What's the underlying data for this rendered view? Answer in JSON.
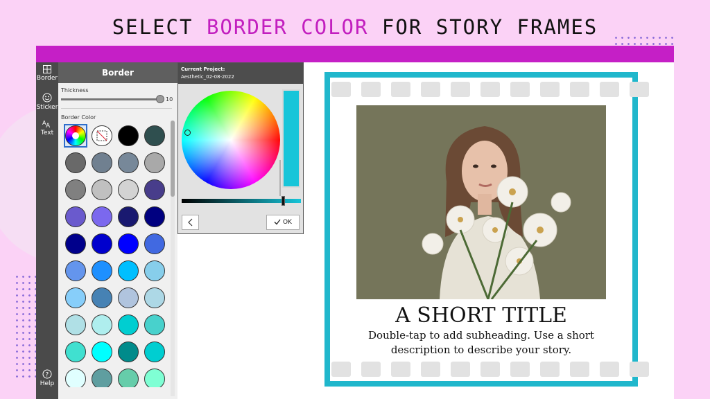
{
  "headline": {
    "part1": "SELECT ",
    "accent": "BORDER COLOR",
    "part2": " FOR STORY FRAMES"
  },
  "colors": {
    "accent": "#c21fbf",
    "border_selected": "#17c5d9",
    "top_bar": "#c51fc6",
    "background": "#fbd2f6"
  },
  "tool_rail": {
    "border": {
      "label": "Border",
      "icon": "border-grid-icon"
    },
    "sticker": {
      "label": "Sticker",
      "icon": "smiley-icon"
    },
    "text": {
      "label": "Text",
      "icon": "text-aa-icon"
    },
    "help": {
      "label": "Help",
      "icon": "help-icon"
    }
  },
  "border_panel": {
    "title": "Border",
    "thickness_label": "Thickness",
    "thickness_value": "10",
    "border_color_label": "Border Color",
    "special_swatches": [
      {
        "name": "color-wheel-swatch",
        "icon": "color-wheel-icon"
      },
      {
        "name": "no-color-swatch",
        "icon": "no-color-icon"
      }
    ],
    "swatch_colors": [
      "#000000",
      "#2f4f4f",
      "#696969",
      "#708090",
      "#778899",
      "#a9a9a9",
      "#808080",
      "#c0c0c0",
      "#d3d3d3",
      "#483d8b",
      "#6a5acd",
      "#7b68ee",
      "#191970",
      "#000080",
      "#00008b",
      "#0000cd",
      "#0000ff",
      "#4169e1",
      "#6495ed",
      "#1e90ff",
      "#00bfff",
      "#87ceeb",
      "#87cefa",
      "#4682b4",
      "#b0c4de",
      "#add8e6",
      "#b0e0e6",
      "#afeeee",
      "#00ced1",
      "#48d1cc",
      "#40e0d0",
      "#00ffff",
      "#008b8b",
      "#00ced1",
      "#e0ffff",
      "#5f9ea0",
      "#66cdaa",
      "#7fffd4"
    ]
  },
  "color_picker": {
    "project_label": "Current Project:",
    "project_name": "Aesthetic_02-08-2022",
    "selected_color": "#17c5d9",
    "value_level": 0.85,
    "back_icon": "chevron-left-icon",
    "ok_label": "OK",
    "ok_icon": "checkmark-icon"
  },
  "story": {
    "title": "A SHORT TITLE",
    "subtitle": "Double-tap to add subheading. Use a short description to describe your story.",
    "photo": "woman-with-white-flowers-photo"
  }
}
